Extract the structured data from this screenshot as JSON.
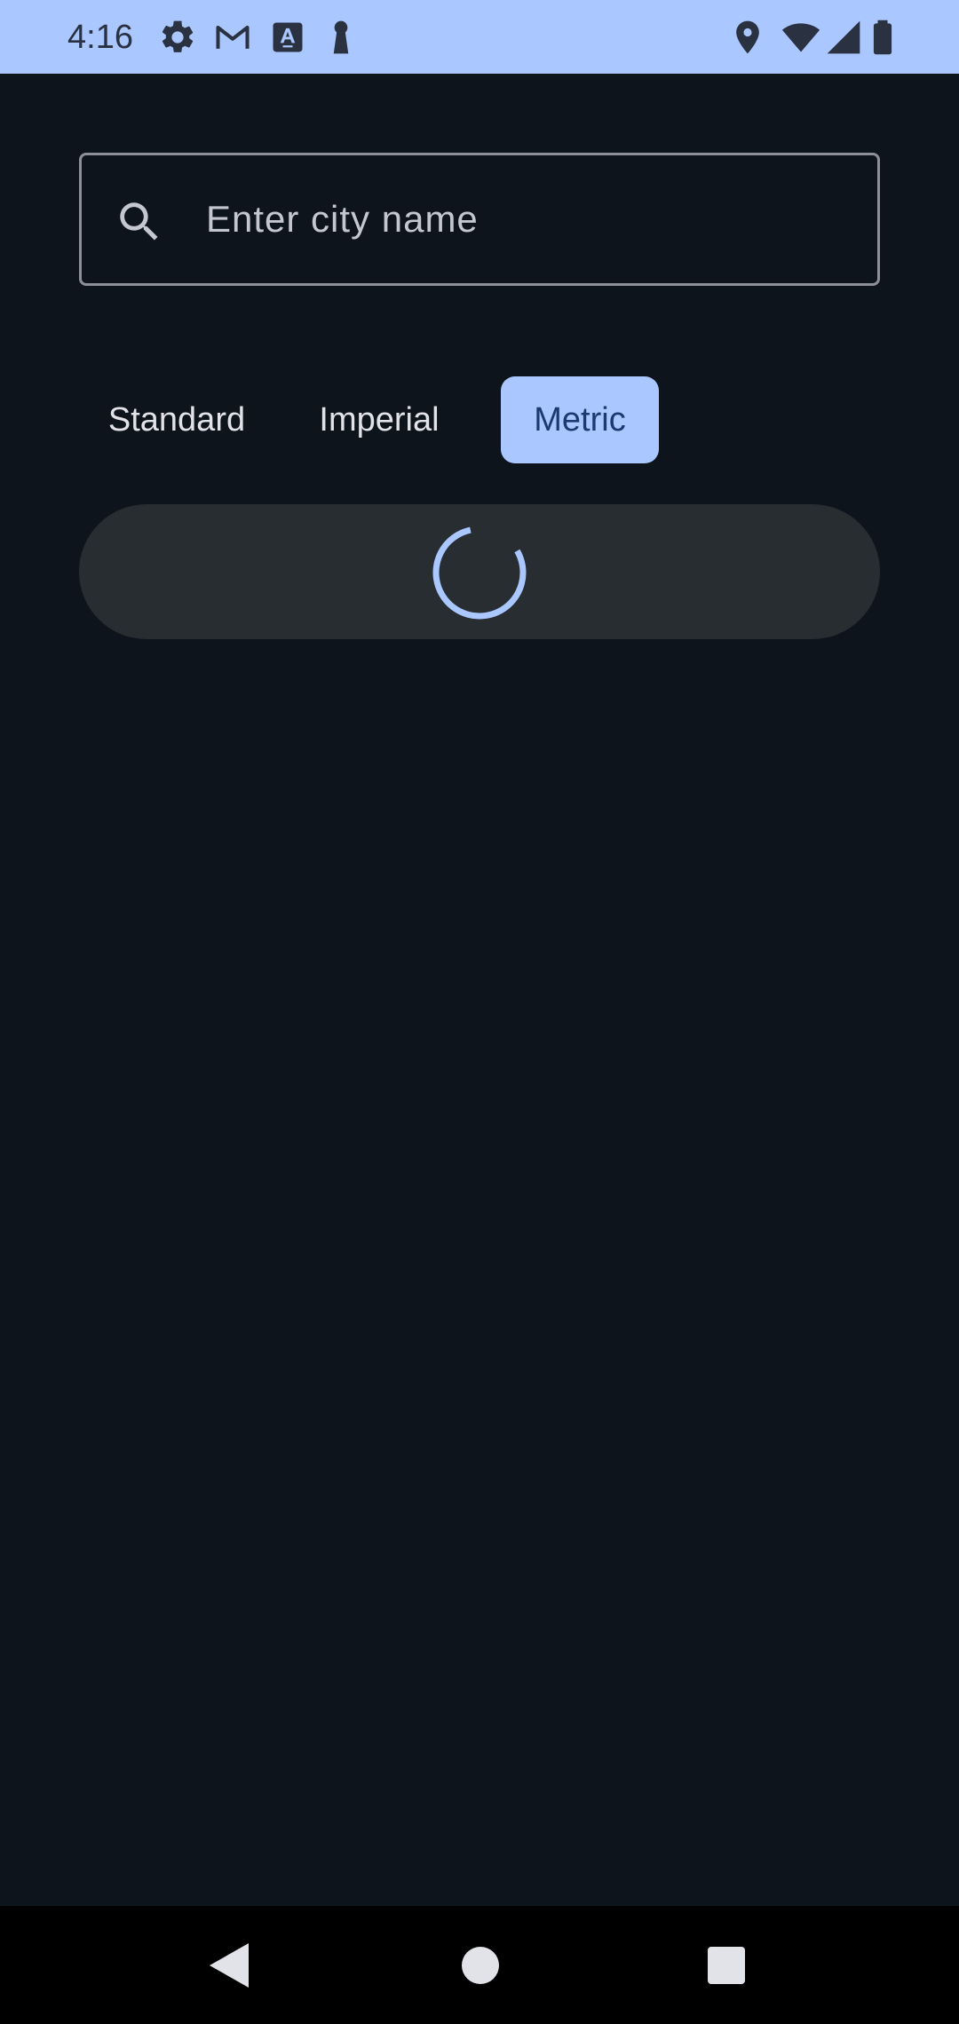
{
  "status_bar": {
    "time": "4:16",
    "left_icons": [
      "settings-icon",
      "gmail-icon",
      "font-icon",
      "keyhole-icon"
    ],
    "right_icons": [
      "location-icon",
      "wifi-icon",
      "signal-icon",
      "battery-icon"
    ]
  },
  "search": {
    "placeholder": "Enter city name",
    "value": ""
  },
  "unit_tabs": {
    "items": [
      {
        "label": "Standard",
        "selected": false
      },
      {
        "label": "Imperial",
        "selected": false
      },
      {
        "label": "Metric",
        "selected": true
      }
    ]
  },
  "loading": {
    "state": "loading"
  },
  "nav_bar": {
    "buttons": [
      "back-icon",
      "home-icon",
      "recents-icon"
    ]
  },
  "colors": {
    "background": "#0e141b",
    "status_bar": "#aac7ff",
    "accent": "#aac7ff",
    "accent_text": "#1b3a73",
    "surface": "#272d31",
    "outline": "#8e9099",
    "on_surface": "#e2e2e9"
  }
}
